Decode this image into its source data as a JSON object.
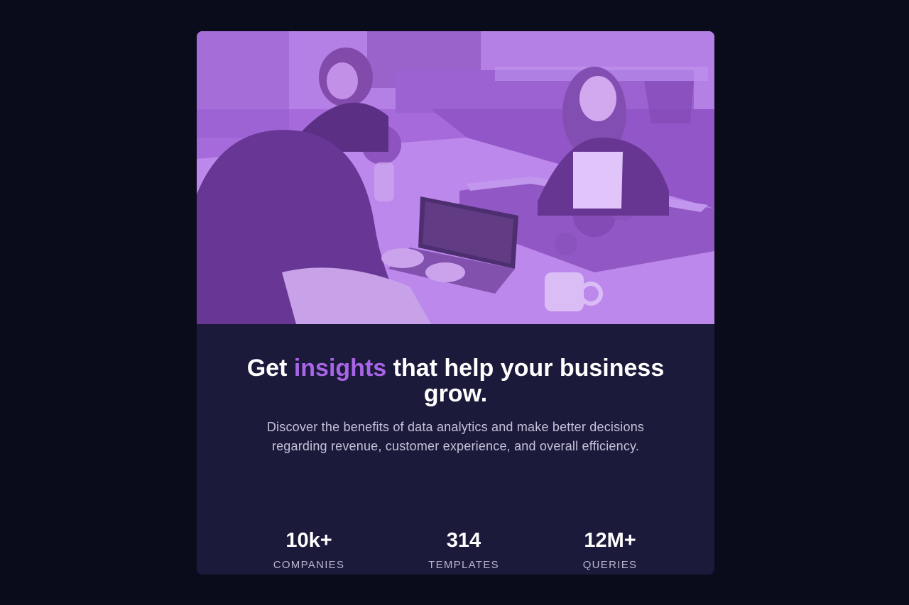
{
  "card": {
    "hero_image": {
      "alt": "",
      "tint_color": "#a865e6"
    },
    "headline": {
      "before": "Get ",
      "accent": "insights",
      "after": " that help your business grow."
    },
    "description": "Discover the benefits of data analytics and make better decisions regarding revenue, customer experience, and overall efficiency.",
    "stats": [
      {
        "value": "10k+",
        "label": "COMPANIES"
      },
      {
        "value": "314",
        "label": "TEMPLATES"
      },
      {
        "value": "12M+",
        "label": "QUERIES"
      }
    ]
  },
  "colors": {
    "page_background": "#0a0c1c",
    "card_background": "#1c1a3b",
    "accent": "#a865e6",
    "text_primary": "#ffffff",
    "text_secondary": "#c5c2d8"
  }
}
